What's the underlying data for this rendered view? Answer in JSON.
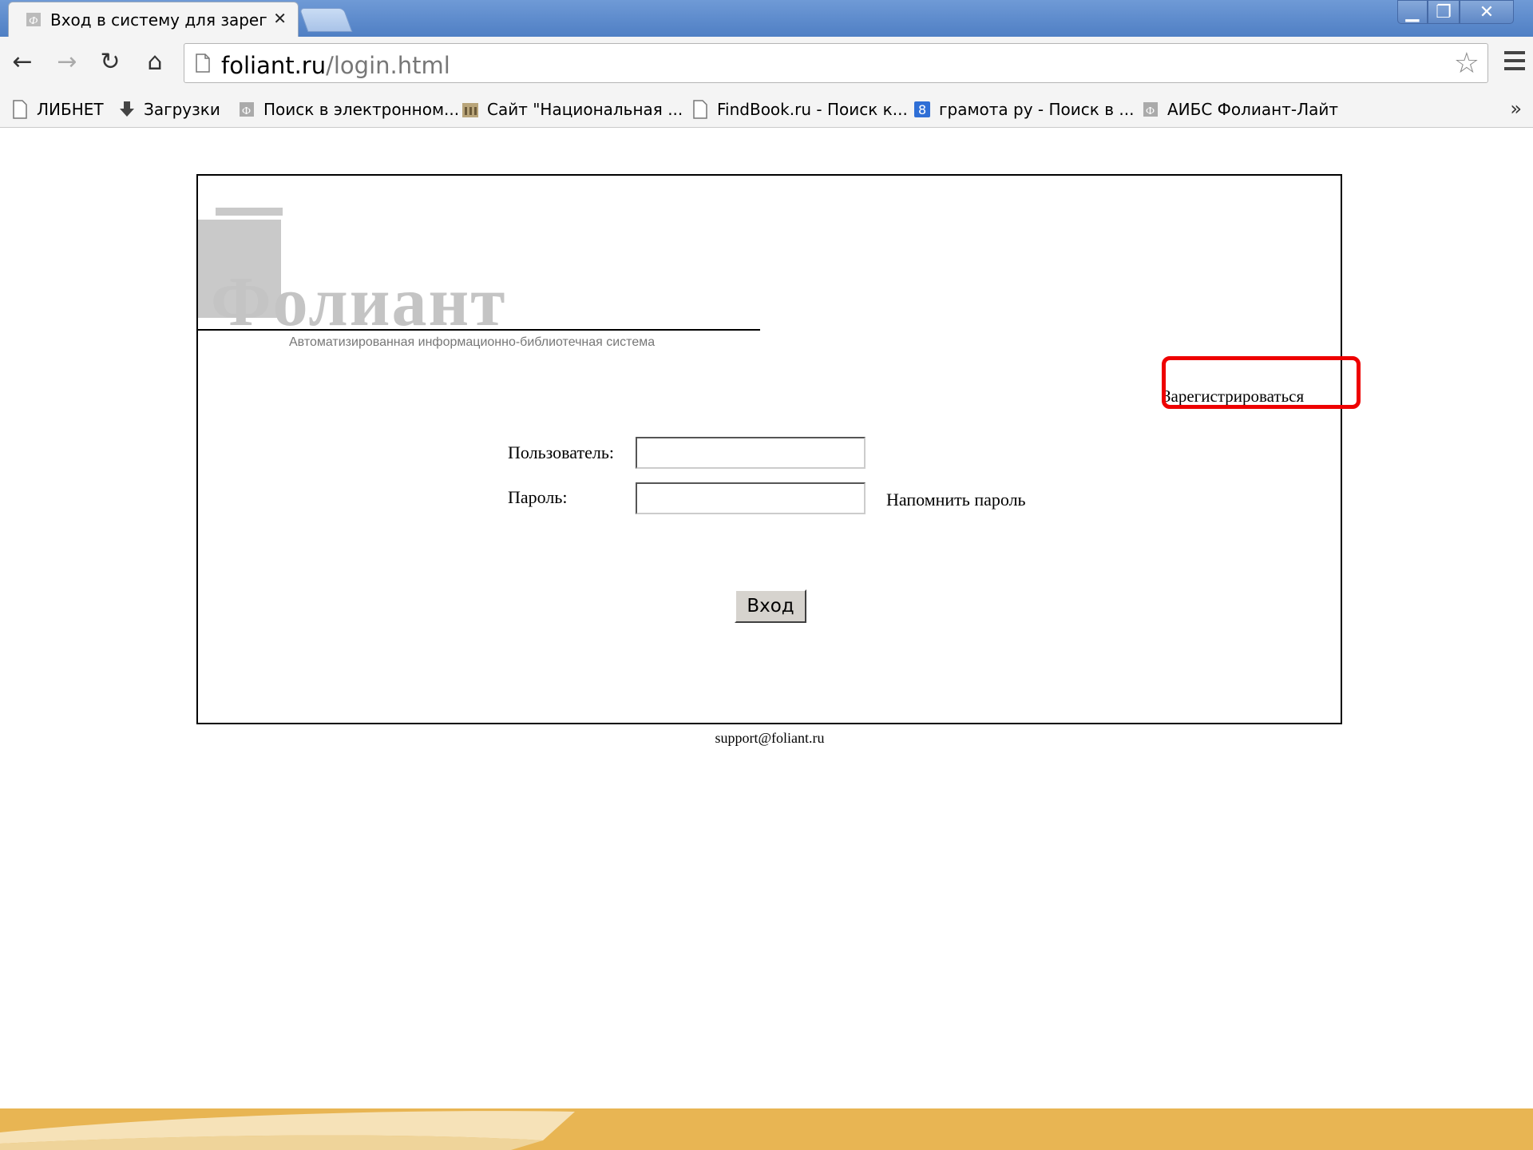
{
  "browser": {
    "tab_title": "Вход в систему для зареги",
    "tab_close": "✕",
    "url_host": "foliant.ru",
    "url_path": "/login.html",
    "window_controls": {
      "minimize": "▁",
      "maximize": "❐",
      "close": "✕"
    },
    "nav_icons": {
      "back": "←",
      "forward": "→",
      "reload": "↻",
      "home": "⌂",
      "star": "☆"
    },
    "bookmarks": [
      {
        "label": "ЛИБНЕТ",
        "icon": "page-icon"
      },
      {
        "label": "Загрузки",
        "icon": "download-icon"
      },
      {
        "label": "Поиск в электронном...",
        "icon": "foliant-icon"
      },
      {
        "label": "Сайт \"Национальная ...",
        "icon": "library-icon"
      },
      {
        "label": "FindBook.ru - Поиск к...",
        "icon": "page-icon"
      },
      {
        "label": "грамота ру - Поиск в ...",
        "icon": "gramota-icon"
      },
      {
        "label": "АИБС Фолиант-Лайт",
        "icon": "foliant-icon"
      }
    ],
    "bookmarks_more": "»"
  },
  "page": {
    "logo_text": "Фолиант",
    "logo_subtitle": "Автоматизированная информационно-библиотечная система",
    "register_link": "Зарегистрироваться",
    "user_label": "Пользователь:",
    "password_label": "Пароль:",
    "remind_password": "Напомнить пароль",
    "login_button": "Вход",
    "support_email": "support@foliant.ru"
  },
  "colors": {
    "highlight": "#ee0000",
    "bottom_band": "#e8b553",
    "logo_grey": "#c4c4c4"
  }
}
